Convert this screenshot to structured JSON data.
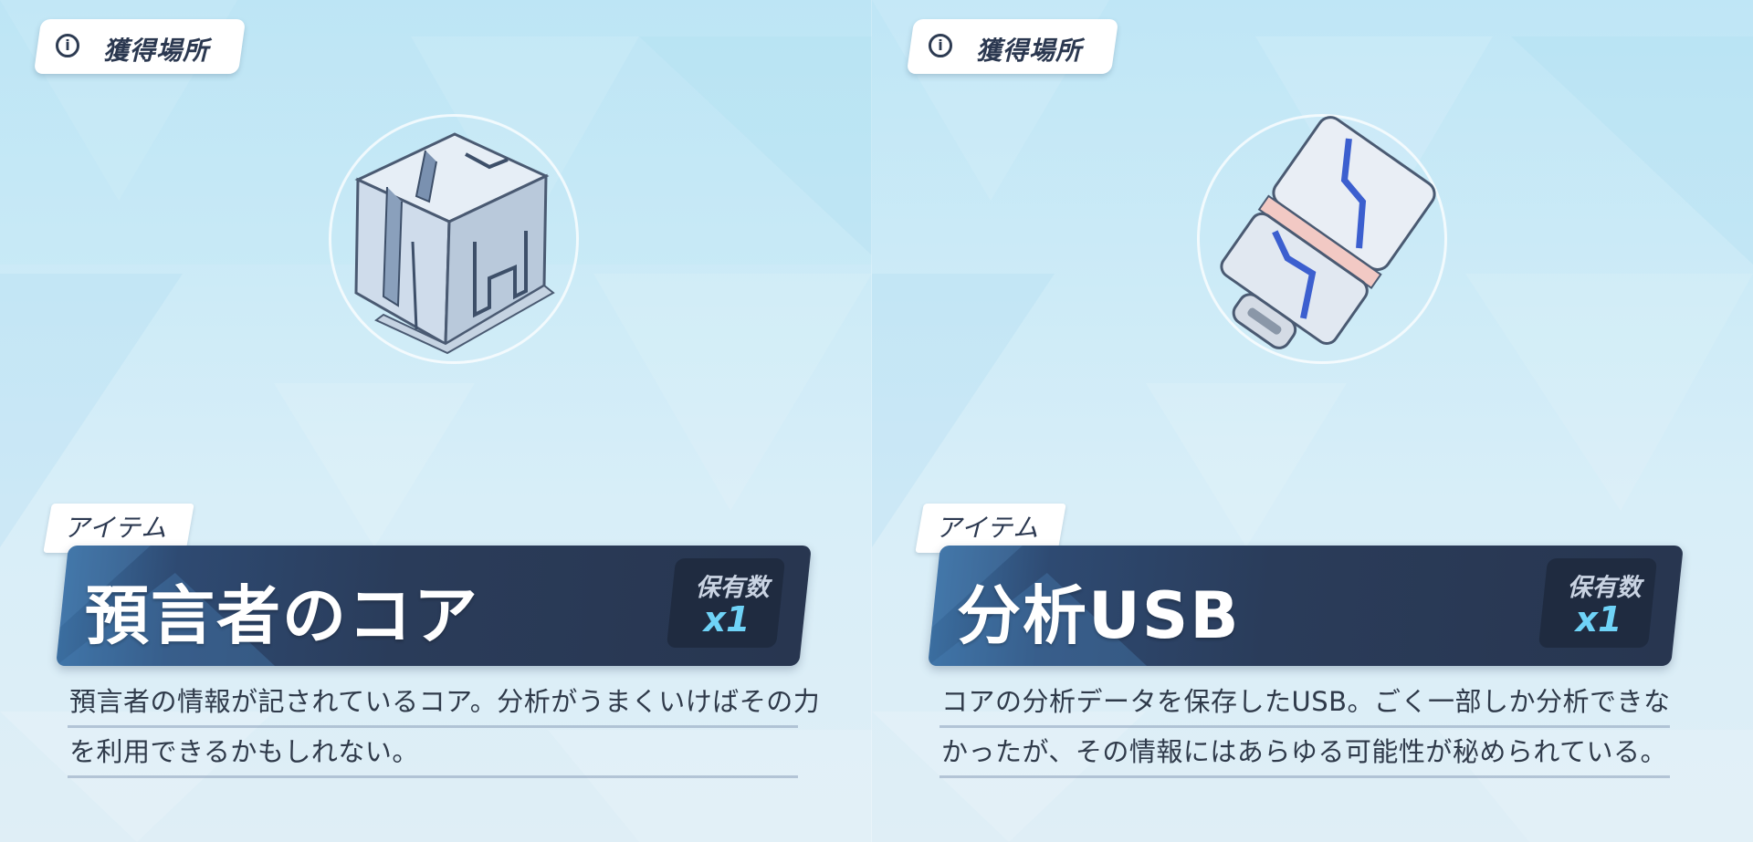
{
  "panels": [
    {
      "source_label": "獲得場所",
      "info_icon": "info-icon",
      "category": "アイテム",
      "name": "預言者のコア",
      "quantity_label": "保有数",
      "quantity_value": "x1",
      "description": [
        "預言者の情報が記されているコア。分析がうまくいけばその力",
        "を利用できるかもしれない。"
      ],
      "art": "crystal-cube-icon"
    },
    {
      "source_label": "獲得場所",
      "info_icon": "info-icon",
      "category": "アイテム",
      "name": "分析USB",
      "quantity_label": "保有数",
      "quantity_value": "x1",
      "description": [
        "コアの分析データを保存したUSB。ごく一部しか分析できな",
        "かったが、その情報にはあらゆる可能性が秘められている。"
      ],
      "art": "usb-drive-icon"
    }
  ],
  "colors": {
    "name_bar": "#283650",
    "quantity_value": "#6fd3f7",
    "background": "#cfeaf6"
  }
}
